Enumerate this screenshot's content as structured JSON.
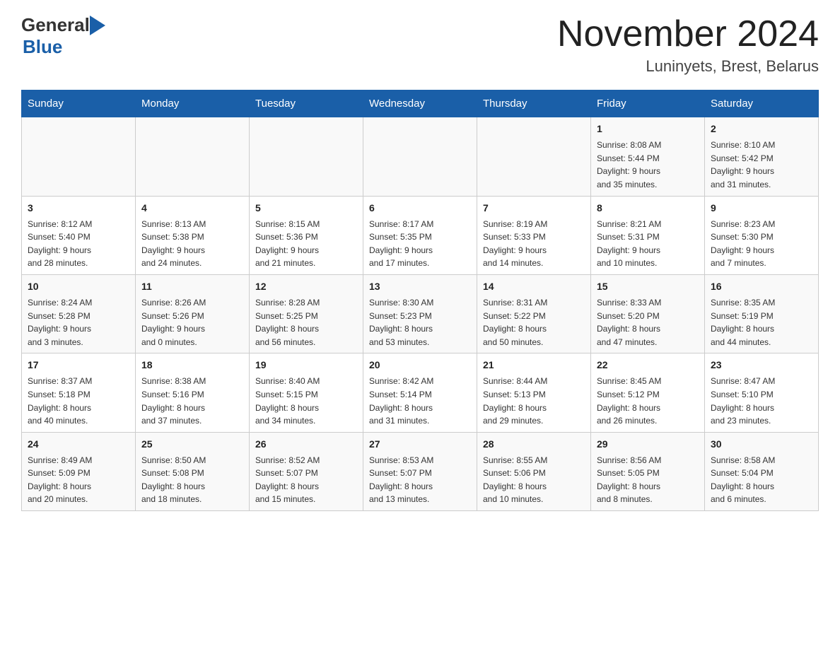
{
  "header": {
    "logo": {
      "general": "General",
      "blue": "Blue"
    },
    "title": "November 2024",
    "location": "Luninyets, Brest, Belarus"
  },
  "days_of_week": [
    "Sunday",
    "Monday",
    "Tuesday",
    "Wednesday",
    "Thursday",
    "Friday",
    "Saturday"
  ],
  "weeks": [
    [
      {
        "day": "",
        "info": ""
      },
      {
        "day": "",
        "info": ""
      },
      {
        "day": "",
        "info": ""
      },
      {
        "day": "",
        "info": ""
      },
      {
        "day": "",
        "info": ""
      },
      {
        "day": "1",
        "info": "Sunrise: 8:08 AM\nSunset: 5:44 PM\nDaylight: 9 hours\nand 35 minutes."
      },
      {
        "day": "2",
        "info": "Sunrise: 8:10 AM\nSunset: 5:42 PM\nDaylight: 9 hours\nand 31 minutes."
      }
    ],
    [
      {
        "day": "3",
        "info": "Sunrise: 8:12 AM\nSunset: 5:40 PM\nDaylight: 9 hours\nand 28 minutes."
      },
      {
        "day": "4",
        "info": "Sunrise: 8:13 AM\nSunset: 5:38 PM\nDaylight: 9 hours\nand 24 minutes."
      },
      {
        "day": "5",
        "info": "Sunrise: 8:15 AM\nSunset: 5:36 PM\nDaylight: 9 hours\nand 21 minutes."
      },
      {
        "day": "6",
        "info": "Sunrise: 8:17 AM\nSunset: 5:35 PM\nDaylight: 9 hours\nand 17 minutes."
      },
      {
        "day": "7",
        "info": "Sunrise: 8:19 AM\nSunset: 5:33 PM\nDaylight: 9 hours\nand 14 minutes."
      },
      {
        "day": "8",
        "info": "Sunrise: 8:21 AM\nSunset: 5:31 PM\nDaylight: 9 hours\nand 10 minutes."
      },
      {
        "day": "9",
        "info": "Sunrise: 8:23 AM\nSunset: 5:30 PM\nDaylight: 9 hours\nand 7 minutes."
      }
    ],
    [
      {
        "day": "10",
        "info": "Sunrise: 8:24 AM\nSunset: 5:28 PM\nDaylight: 9 hours\nand 3 minutes."
      },
      {
        "day": "11",
        "info": "Sunrise: 8:26 AM\nSunset: 5:26 PM\nDaylight: 9 hours\nand 0 minutes."
      },
      {
        "day": "12",
        "info": "Sunrise: 8:28 AM\nSunset: 5:25 PM\nDaylight: 8 hours\nand 56 minutes."
      },
      {
        "day": "13",
        "info": "Sunrise: 8:30 AM\nSunset: 5:23 PM\nDaylight: 8 hours\nand 53 minutes."
      },
      {
        "day": "14",
        "info": "Sunrise: 8:31 AM\nSunset: 5:22 PM\nDaylight: 8 hours\nand 50 minutes."
      },
      {
        "day": "15",
        "info": "Sunrise: 8:33 AM\nSunset: 5:20 PM\nDaylight: 8 hours\nand 47 minutes."
      },
      {
        "day": "16",
        "info": "Sunrise: 8:35 AM\nSunset: 5:19 PM\nDaylight: 8 hours\nand 44 minutes."
      }
    ],
    [
      {
        "day": "17",
        "info": "Sunrise: 8:37 AM\nSunset: 5:18 PM\nDaylight: 8 hours\nand 40 minutes."
      },
      {
        "day": "18",
        "info": "Sunrise: 8:38 AM\nSunset: 5:16 PM\nDaylight: 8 hours\nand 37 minutes."
      },
      {
        "day": "19",
        "info": "Sunrise: 8:40 AM\nSunset: 5:15 PM\nDaylight: 8 hours\nand 34 minutes."
      },
      {
        "day": "20",
        "info": "Sunrise: 8:42 AM\nSunset: 5:14 PM\nDaylight: 8 hours\nand 31 minutes."
      },
      {
        "day": "21",
        "info": "Sunrise: 8:44 AM\nSunset: 5:13 PM\nDaylight: 8 hours\nand 29 minutes."
      },
      {
        "day": "22",
        "info": "Sunrise: 8:45 AM\nSunset: 5:12 PM\nDaylight: 8 hours\nand 26 minutes."
      },
      {
        "day": "23",
        "info": "Sunrise: 8:47 AM\nSunset: 5:10 PM\nDaylight: 8 hours\nand 23 minutes."
      }
    ],
    [
      {
        "day": "24",
        "info": "Sunrise: 8:49 AM\nSunset: 5:09 PM\nDaylight: 8 hours\nand 20 minutes."
      },
      {
        "day": "25",
        "info": "Sunrise: 8:50 AM\nSunset: 5:08 PM\nDaylight: 8 hours\nand 18 minutes."
      },
      {
        "day": "26",
        "info": "Sunrise: 8:52 AM\nSunset: 5:07 PM\nDaylight: 8 hours\nand 15 minutes."
      },
      {
        "day": "27",
        "info": "Sunrise: 8:53 AM\nSunset: 5:07 PM\nDaylight: 8 hours\nand 13 minutes."
      },
      {
        "day": "28",
        "info": "Sunrise: 8:55 AM\nSunset: 5:06 PM\nDaylight: 8 hours\nand 10 minutes."
      },
      {
        "day": "29",
        "info": "Sunrise: 8:56 AM\nSunset: 5:05 PM\nDaylight: 8 hours\nand 8 minutes."
      },
      {
        "day": "30",
        "info": "Sunrise: 8:58 AM\nSunset: 5:04 PM\nDaylight: 8 hours\nand 6 minutes."
      }
    ]
  ]
}
